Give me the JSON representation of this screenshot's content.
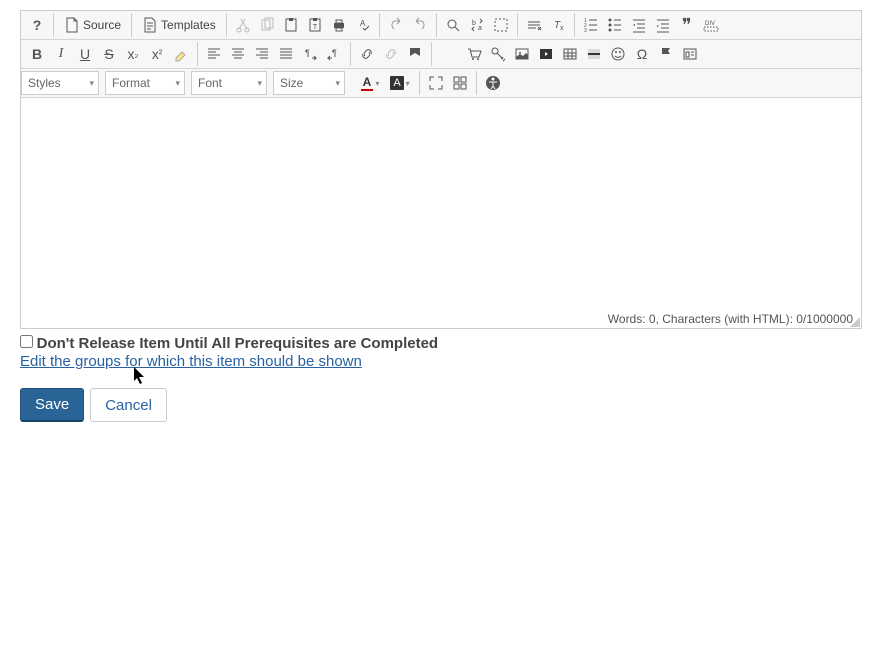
{
  "toolbar": {
    "source_label": "Source",
    "templates_label": "Templates"
  },
  "dropdowns": {
    "styles": "Styles",
    "format": "Format",
    "font": "Font",
    "size": "Size"
  },
  "footer": {
    "status": "Words: 0, Characters (with HTML): 0/1000000"
  },
  "checkbox": {
    "label": "Don't Release Item Until All Prerequisites are Completed"
  },
  "link": {
    "edit_groups": "Edit the groups for which this item should be shown"
  },
  "buttons": {
    "save": "Save",
    "cancel": "Cancel"
  }
}
